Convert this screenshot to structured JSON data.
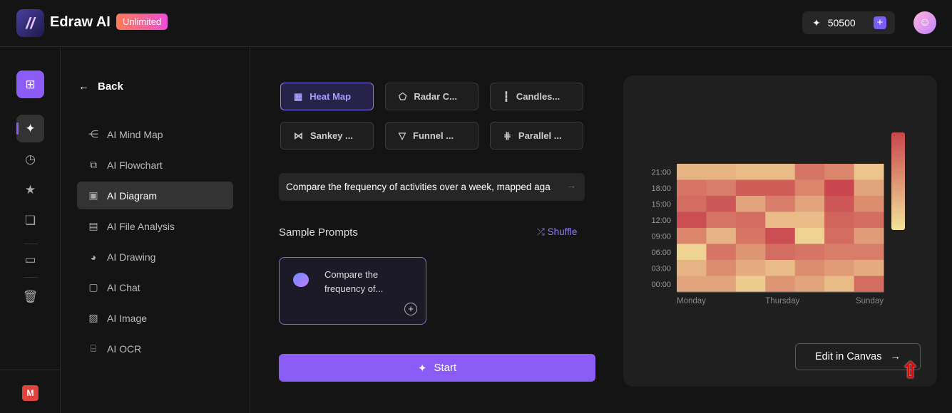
{
  "header": {
    "brand": "Edraw AI",
    "badge": "Unlimited",
    "credits": "50500",
    "add": "+",
    "avatar_icon": "user-icon"
  },
  "rail": {
    "items": [
      "new",
      "ai",
      "recent",
      "favorites",
      "templates",
      "files",
      "trash"
    ],
    "user_badge": "M"
  },
  "sidebar": {
    "back": "Back",
    "items": [
      {
        "label": "AI Mind Map",
        "icon": "mindmap-icon"
      },
      {
        "label": "AI Flowchart",
        "icon": "flowchart-icon"
      },
      {
        "label": "AI Diagram",
        "icon": "diagram-icon",
        "selected": true
      },
      {
        "label": "AI File Analysis",
        "icon": "file-analysis-icon"
      },
      {
        "label": "AI Drawing",
        "icon": "palette-icon"
      },
      {
        "label": "AI Chat",
        "icon": "chat-icon"
      },
      {
        "label": "AI Image",
        "icon": "image-icon"
      },
      {
        "label": "AI OCR",
        "icon": "ocr-icon"
      }
    ]
  },
  "main": {
    "chart_types": [
      {
        "label": "Heat Map",
        "glyph": "▦",
        "selected": true
      },
      {
        "label": "Radar C...",
        "glyph": "⬠"
      },
      {
        "label": "Candles...",
        "glyph": "┇"
      },
      {
        "label": "Sankey ...",
        "glyph": "⋈"
      },
      {
        "label": "Funnel ...",
        "glyph": "▽"
      },
      {
        "label": "Parallel ...",
        "glyph": "⋕"
      }
    ],
    "prompt": "Compare the frequency of activities over a week, mapped aga",
    "sample_title": "Sample Prompts",
    "shuffle": "Shuffle",
    "sample_card": "Compare the frequency of...",
    "start": "Start"
  },
  "preview": {
    "edit": "Edit in Canvas",
    "colors": {
      "low": "#f3e39a",
      "high": "#c9464e"
    }
  },
  "chart_data": {
    "type": "heatmap",
    "x_tick_labels": [
      "Monday",
      "Thursday",
      "Sunday"
    ],
    "x_count": 7,
    "y_labels": [
      "21:00",
      "18:00",
      "15:00",
      "12:00",
      "09:00",
      "06:00",
      "03:00",
      "00:00"
    ],
    "values": [
      [
        3,
        3,
        2.5,
        2.5,
        7,
        6,
        2
      ],
      [
        7,
        6.5,
        8.5,
        8.5,
        6,
        10,
        4
      ],
      [
        7.5,
        9,
        4,
        6.5,
        4,
        9,
        5.5
      ],
      [
        9.5,
        7,
        7.5,
        2.5,
        2.5,
        8,
        7.5
      ],
      [
        6,
        3,
        7,
        9.5,
        1,
        7.5,
        4.5
      ],
      [
        1,
        7,
        5,
        7.5,
        7,
        6.5,
        6.5
      ],
      [
        3,
        5.5,
        3.5,
        2.5,
        5.5,
        4.5,
        3.5
      ],
      [
        4,
        4,
        1.5,
        5,
        4,
        2.5,
        7.5
      ]
    ],
    "range": [
      0,
      10
    ],
    "legend": "right (continuous color bar)"
  }
}
